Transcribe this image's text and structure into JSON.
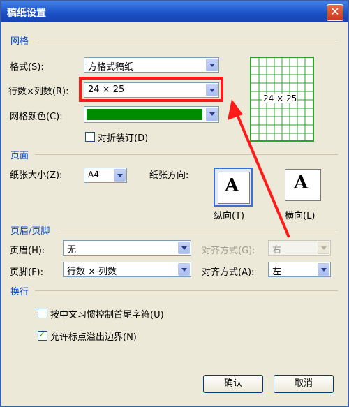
{
  "window": {
    "title": "稿纸设置",
    "close_label": "✕"
  },
  "grid_section": {
    "title": "网格",
    "format_label": "格式(S):",
    "format_value": "方格式稿纸",
    "rowcol_label": "行数×列数(R):",
    "rowcol_value": "24 × 25",
    "color_label": "网格颜色(C):",
    "color_value": "#008c00",
    "fold_label": "对折装订(D)",
    "preview_text": "24 × 25"
  },
  "page_section": {
    "title": "页面",
    "size_label": "纸张大小(Z):",
    "size_value": "A4",
    "orientation_label": "纸张方向:",
    "portrait_label": "纵向(T)",
    "landscape_label": "横向(L)",
    "orient_icon": "A"
  },
  "header_section": {
    "title": "页眉/页脚",
    "header_label": "页眉(H):",
    "header_value": "无",
    "header_align_label": "对齐方式(G):",
    "header_align_value": "右",
    "footer_label": "页脚(F):",
    "footer_value": "行数 × 列数",
    "footer_align_label": "对齐方式(A):",
    "footer_align_value": "左"
  },
  "wrap_section": {
    "title": "换行",
    "opt1_label": "按中文习惯控制首尾字符(U)",
    "opt2_label": "允许标点溢出边界(N)"
  },
  "buttons": {
    "ok": "确认",
    "cancel": "取消"
  },
  "colors": {
    "highlight": "#ff1a1a",
    "grid_green": "#2aa52a"
  }
}
